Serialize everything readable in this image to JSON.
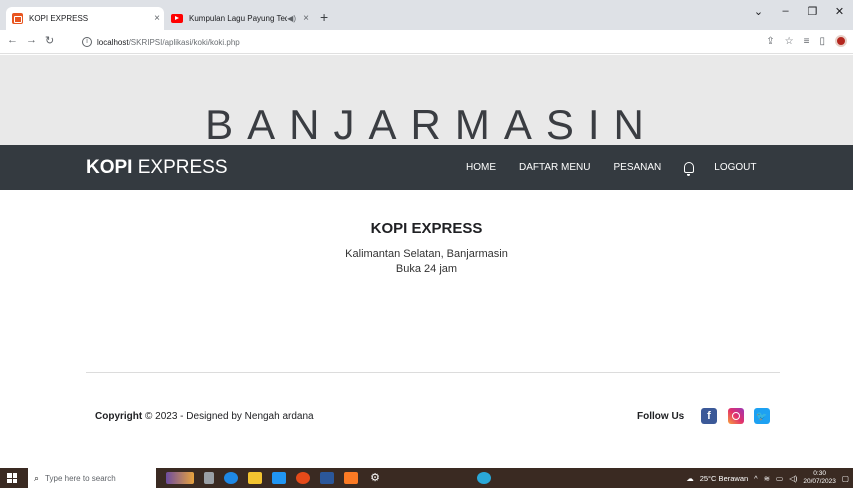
{
  "browser": {
    "tabs": [
      {
        "title": "KOPI EXPRESS",
        "active": true
      },
      {
        "title": "Kumpulan Lagu Payung Teduh",
        "active": false
      }
    ],
    "url_host": "localhost",
    "url_path": "/SKRIPSI/aplikasi/koki/koki.php",
    "new_tab_label": "+",
    "close_glyph": "×"
  },
  "site": {
    "banner": "BANJARMASIN",
    "brand_bold": "KOPI",
    "brand_rest": " EXPRESS",
    "nav": {
      "home": "HOME",
      "menu": "DAFTAR MENU",
      "orders": "PESANAN",
      "logout": "LOGOUT"
    },
    "info": {
      "title": "KOPI EXPRESS",
      "address": "Kalimantan Selatan, Banjarmasin",
      "hours": "Buka 24 jam"
    },
    "footer": {
      "copyright_bold": "Copyright",
      "copyright_symbol": "©",
      "copyright_text": " 2023 - Designed by Nengah ardana",
      "follow": "Follow Us"
    }
  },
  "taskbar": {
    "search_placeholder": "Type here to search",
    "weather": "25°C  Berawan",
    "time": "0:30",
    "date": "20/07/2023"
  },
  "colors": {
    "navbar": "#343a40",
    "banner": "#e9e9e9",
    "facebook": "#3b5998",
    "twitter": "#1da1f2"
  }
}
